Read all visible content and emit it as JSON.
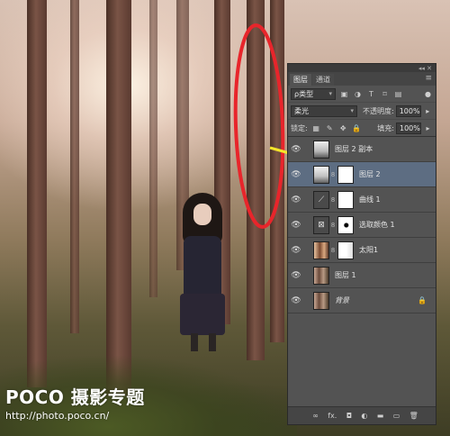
{
  "watermark": {
    "logo": "POCO 摄影专题",
    "url": "http://photo.poco.cn/"
  },
  "panel": {
    "title_collapse": "◂◂",
    "title_close": "✕",
    "tabs": [
      {
        "label": "图层",
        "active": true
      },
      {
        "label": "通道",
        "active": false
      }
    ],
    "menu_icon": "≡",
    "filter": {
      "label": "ρ类型",
      "icons": [
        "image-filter-icon",
        "adjustment-filter-icon",
        "text-filter-icon",
        "shape-filter-icon",
        "smart-object-filter-icon"
      ]
    },
    "blend_mode": "柔光",
    "opacity_label": "不透明度:",
    "opacity_value": "100%",
    "lock_label": "锁定:",
    "fill_label": "填充:",
    "fill_value": "100%",
    "layers": [
      {
        "name": "图层 2 副本",
        "visible": true,
        "selected": false,
        "has_mask": false,
        "thumb": "foggy-forest"
      },
      {
        "name": "图层 2",
        "visible": true,
        "selected": true,
        "has_mask": true,
        "thumb": "foggy-forest"
      },
      {
        "name": "曲线 1",
        "visible": true,
        "selected": false,
        "has_mask": true,
        "thumb": "curves-adjustment"
      },
      {
        "name": "选取颜色 1",
        "visible": true,
        "selected": false,
        "has_mask": true,
        "thumb": "selective-color-adjustment"
      },
      {
        "name": "太阳1",
        "visible": true,
        "selected": false,
        "has_mask": true,
        "thumb": "sun-photo"
      },
      {
        "name": "图层 1",
        "visible": true,
        "selected": false,
        "has_mask": false,
        "thumb": "forest-photo"
      },
      {
        "name": "背景",
        "visible": true,
        "selected": false,
        "has_mask": false,
        "thumb": "forest-photo",
        "locked": true
      }
    ],
    "footer_icons": [
      "∞",
      "fx.",
      "◘",
      "◐",
      "▬",
      "▭",
      "🗑"
    ]
  },
  "colors": {
    "annotation_red": "#e8252b",
    "arrow_yellow": "#f5e62a",
    "panel_bg": "#535353",
    "selected_layer": "#5d6d82"
  }
}
